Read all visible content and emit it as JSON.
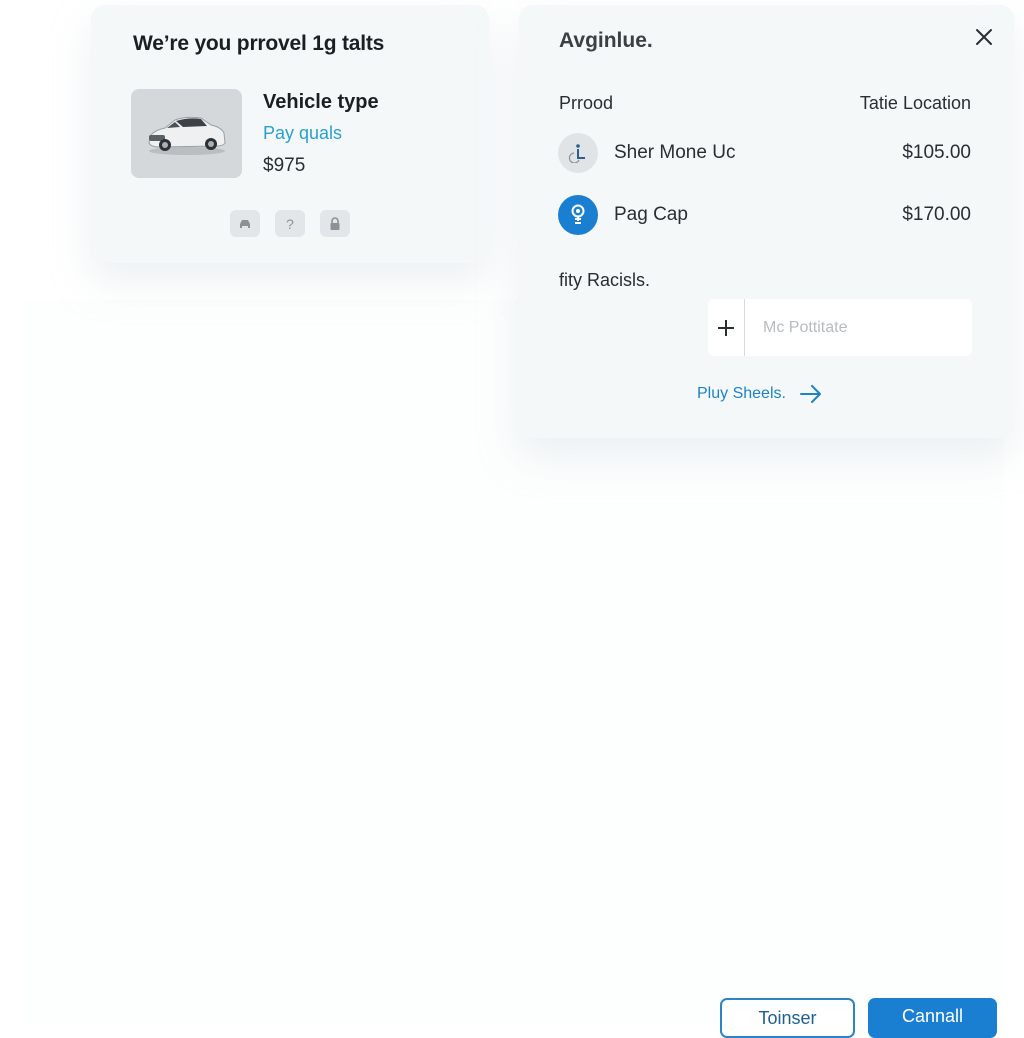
{
  "vehicle_card": {
    "title": "We’re you prrovel 1g talts",
    "vehicle_title": "Vehicle type",
    "vehicle_link": "Pay quals",
    "vehicle_price": "$975",
    "image_icon": "car-image",
    "mini_icons": [
      {
        "name": "car-icon",
        "glyph": "⛟"
      },
      {
        "name": "help-icon",
        "glyph": "?"
      },
      {
        "name": "lock-icon",
        "glyph": "🔒"
      }
    ]
  },
  "detail_panel": {
    "title": "Avginlue.",
    "close_icon": "close-icon",
    "columns": {
      "left": "Prrood",
      "right": "Tatie Location"
    },
    "rows": [
      {
        "icon": "accessibility-icon",
        "name": "Sher Mone Uc",
        "amount": "$105.00"
      },
      {
        "icon": "location-pin-icon",
        "name": "Pag Cap",
        "amount": "$170.00"
      }
    ],
    "section_label": "fity Racisls.",
    "input": {
      "value": "",
      "placeholder": "Mc Pottitate",
      "add_icon": "plus-icon"
    },
    "action_link": {
      "label": "Pluy Sheels.",
      "icon": "arrow-right-icon"
    }
  },
  "footer": {
    "secondary_button": "Toinser",
    "primary_button": "Cannall"
  },
  "colors": {
    "accent": "#1a7fd0",
    "link": "#2aa0d0",
    "card_bg": "#f4f8f9"
  }
}
